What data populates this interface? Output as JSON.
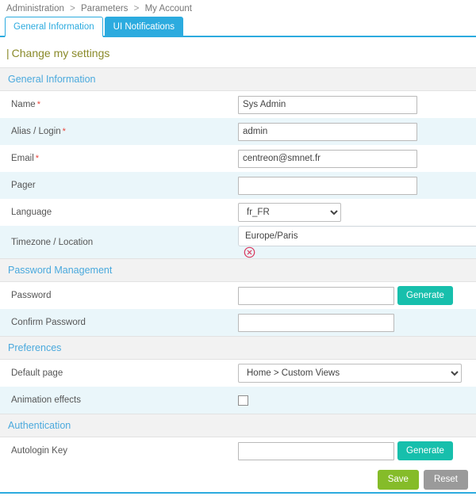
{
  "breadcrumb": {
    "items": [
      "Administration",
      "Parameters",
      "My Account"
    ],
    "separator": ">"
  },
  "tabs": [
    {
      "label": "General Information",
      "active": true
    },
    {
      "label": "UI Notifications",
      "active": false
    }
  ],
  "page_title": {
    "prefix": "|",
    "text": "Change my settings"
  },
  "sections": {
    "general": {
      "title": "General Information",
      "fields": {
        "name": {
          "label": "Name",
          "required": true,
          "value": "Sys Admin"
        },
        "alias": {
          "label": "Alias / Login",
          "required": true,
          "value": "admin"
        },
        "email": {
          "label": "Email",
          "required": true,
          "value": "centreon@smnet.fr"
        },
        "pager": {
          "label": "Pager",
          "required": false,
          "value": ""
        },
        "language": {
          "label": "Language",
          "value": "fr_FR"
        },
        "timezone": {
          "label": "Timezone / Location",
          "value": "Europe/Paris"
        }
      }
    },
    "password": {
      "title": "Password Management",
      "fields": {
        "password": {
          "label": "Password",
          "value": "",
          "button": "Generate"
        },
        "confirm": {
          "label": "Confirm Password",
          "value": ""
        }
      }
    },
    "preferences": {
      "title": "Preferences",
      "fields": {
        "default_page": {
          "label": "Default page",
          "value": "Home > Custom Views"
        },
        "animation": {
          "label": "Animation effects",
          "checked": false
        }
      }
    },
    "authentication": {
      "title": "Authentication",
      "fields": {
        "autologin": {
          "label": "Autologin Key",
          "value": "",
          "button": "Generate"
        }
      }
    }
  },
  "actions": {
    "save": "Save",
    "reset": "Reset"
  },
  "icons": {
    "clear": "clear-circle-icon",
    "chevron": "chevron-down-icon"
  },
  "colors": {
    "accent_cyan": "#2cabdf",
    "section_text": "#4aa9dd",
    "title_olive": "#8a8a2a",
    "generate_teal": "#17bfac",
    "save_green": "#85bc29",
    "reset_gray": "#9a9a9a",
    "required_red": "#e8443a",
    "row_alt": "#eaf6fa"
  }
}
